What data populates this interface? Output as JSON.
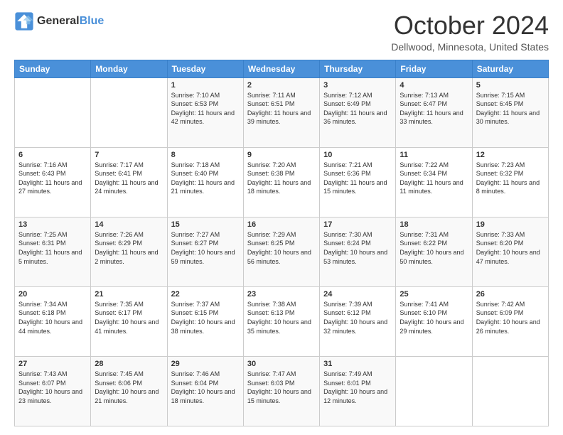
{
  "header": {
    "logo_general": "General",
    "logo_blue": "Blue",
    "month_title": "October 2024",
    "location": "Dellwood, Minnesota, United States"
  },
  "weekdays": [
    "Sunday",
    "Monday",
    "Tuesday",
    "Wednesday",
    "Thursday",
    "Friday",
    "Saturday"
  ],
  "weeks": [
    [
      {
        "day": "",
        "detail": ""
      },
      {
        "day": "",
        "detail": ""
      },
      {
        "day": "1",
        "detail": "Sunrise: 7:10 AM\nSunset: 6:53 PM\nDaylight: 11 hours and 42 minutes."
      },
      {
        "day": "2",
        "detail": "Sunrise: 7:11 AM\nSunset: 6:51 PM\nDaylight: 11 hours and 39 minutes."
      },
      {
        "day": "3",
        "detail": "Sunrise: 7:12 AM\nSunset: 6:49 PM\nDaylight: 11 hours and 36 minutes."
      },
      {
        "day": "4",
        "detail": "Sunrise: 7:13 AM\nSunset: 6:47 PM\nDaylight: 11 hours and 33 minutes."
      },
      {
        "day": "5",
        "detail": "Sunrise: 7:15 AM\nSunset: 6:45 PM\nDaylight: 11 hours and 30 minutes."
      }
    ],
    [
      {
        "day": "6",
        "detail": "Sunrise: 7:16 AM\nSunset: 6:43 PM\nDaylight: 11 hours and 27 minutes."
      },
      {
        "day": "7",
        "detail": "Sunrise: 7:17 AM\nSunset: 6:41 PM\nDaylight: 11 hours and 24 minutes."
      },
      {
        "day": "8",
        "detail": "Sunrise: 7:18 AM\nSunset: 6:40 PM\nDaylight: 11 hours and 21 minutes."
      },
      {
        "day": "9",
        "detail": "Sunrise: 7:20 AM\nSunset: 6:38 PM\nDaylight: 11 hours and 18 minutes."
      },
      {
        "day": "10",
        "detail": "Sunrise: 7:21 AM\nSunset: 6:36 PM\nDaylight: 11 hours and 15 minutes."
      },
      {
        "day": "11",
        "detail": "Sunrise: 7:22 AM\nSunset: 6:34 PM\nDaylight: 11 hours and 11 minutes."
      },
      {
        "day": "12",
        "detail": "Sunrise: 7:23 AM\nSunset: 6:32 PM\nDaylight: 11 hours and 8 minutes."
      }
    ],
    [
      {
        "day": "13",
        "detail": "Sunrise: 7:25 AM\nSunset: 6:31 PM\nDaylight: 11 hours and 5 minutes."
      },
      {
        "day": "14",
        "detail": "Sunrise: 7:26 AM\nSunset: 6:29 PM\nDaylight: 11 hours and 2 minutes."
      },
      {
        "day": "15",
        "detail": "Sunrise: 7:27 AM\nSunset: 6:27 PM\nDaylight: 10 hours and 59 minutes."
      },
      {
        "day": "16",
        "detail": "Sunrise: 7:29 AM\nSunset: 6:25 PM\nDaylight: 10 hours and 56 minutes."
      },
      {
        "day": "17",
        "detail": "Sunrise: 7:30 AM\nSunset: 6:24 PM\nDaylight: 10 hours and 53 minutes."
      },
      {
        "day": "18",
        "detail": "Sunrise: 7:31 AM\nSunset: 6:22 PM\nDaylight: 10 hours and 50 minutes."
      },
      {
        "day": "19",
        "detail": "Sunrise: 7:33 AM\nSunset: 6:20 PM\nDaylight: 10 hours and 47 minutes."
      }
    ],
    [
      {
        "day": "20",
        "detail": "Sunrise: 7:34 AM\nSunset: 6:18 PM\nDaylight: 10 hours and 44 minutes."
      },
      {
        "day": "21",
        "detail": "Sunrise: 7:35 AM\nSunset: 6:17 PM\nDaylight: 10 hours and 41 minutes."
      },
      {
        "day": "22",
        "detail": "Sunrise: 7:37 AM\nSunset: 6:15 PM\nDaylight: 10 hours and 38 minutes."
      },
      {
        "day": "23",
        "detail": "Sunrise: 7:38 AM\nSunset: 6:13 PM\nDaylight: 10 hours and 35 minutes."
      },
      {
        "day": "24",
        "detail": "Sunrise: 7:39 AM\nSunset: 6:12 PM\nDaylight: 10 hours and 32 minutes."
      },
      {
        "day": "25",
        "detail": "Sunrise: 7:41 AM\nSunset: 6:10 PM\nDaylight: 10 hours and 29 minutes."
      },
      {
        "day": "26",
        "detail": "Sunrise: 7:42 AM\nSunset: 6:09 PM\nDaylight: 10 hours and 26 minutes."
      }
    ],
    [
      {
        "day": "27",
        "detail": "Sunrise: 7:43 AM\nSunset: 6:07 PM\nDaylight: 10 hours and 23 minutes."
      },
      {
        "day": "28",
        "detail": "Sunrise: 7:45 AM\nSunset: 6:06 PM\nDaylight: 10 hours and 21 minutes."
      },
      {
        "day": "29",
        "detail": "Sunrise: 7:46 AM\nSunset: 6:04 PM\nDaylight: 10 hours and 18 minutes."
      },
      {
        "day": "30",
        "detail": "Sunrise: 7:47 AM\nSunset: 6:03 PM\nDaylight: 10 hours and 15 minutes."
      },
      {
        "day": "31",
        "detail": "Sunrise: 7:49 AM\nSunset: 6:01 PM\nDaylight: 10 hours and 12 minutes."
      },
      {
        "day": "",
        "detail": ""
      },
      {
        "day": "",
        "detail": ""
      }
    ]
  ]
}
